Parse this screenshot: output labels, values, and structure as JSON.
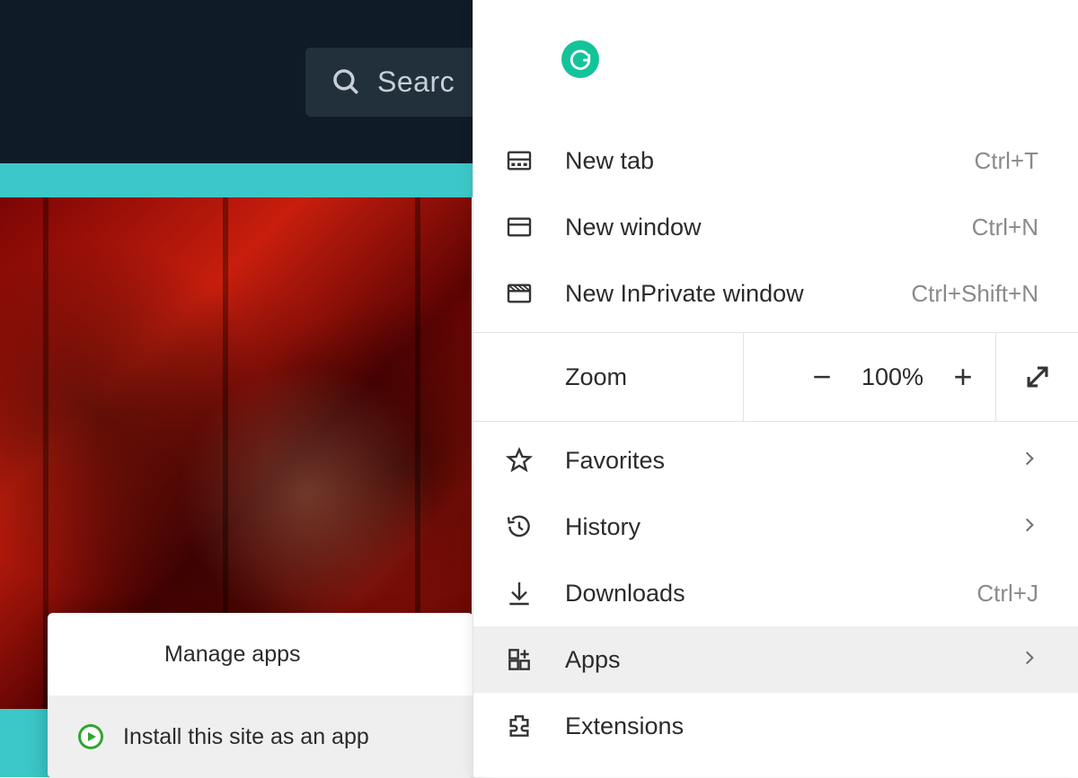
{
  "background": {
    "search_placeholder": "Searc"
  },
  "submenu": {
    "items": [
      {
        "label": "Manage apps",
        "icon": null,
        "hover": false
      },
      {
        "label": "Install this site as an app",
        "icon": "play-green-icon",
        "hover": true
      }
    ]
  },
  "menu": {
    "zoom_label": "Zoom",
    "zoom_value": "100%",
    "items_top": [
      {
        "label": "New tab",
        "shortcut": "Ctrl+T",
        "icon": "new-tab-icon"
      },
      {
        "label": "New window",
        "shortcut": "Ctrl+N",
        "icon": "window-icon"
      },
      {
        "label": "New InPrivate window",
        "shortcut": "Ctrl+Shift+N",
        "icon": "inprivate-icon"
      }
    ],
    "items_mid": [
      {
        "label": "Favorites",
        "icon": "star-icon",
        "chevron": true
      },
      {
        "label": "History",
        "icon": "history-icon",
        "chevron": true
      },
      {
        "label": "Downloads",
        "shortcut": "Ctrl+J",
        "icon": "download-icon"
      },
      {
        "label": "Apps",
        "icon": "apps-icon",
        "chevron": true,
        "hover": true
      },
      {
        "label": "Extensions",
        "icon": "extensions-icon"
      }
    ]
  }
}
